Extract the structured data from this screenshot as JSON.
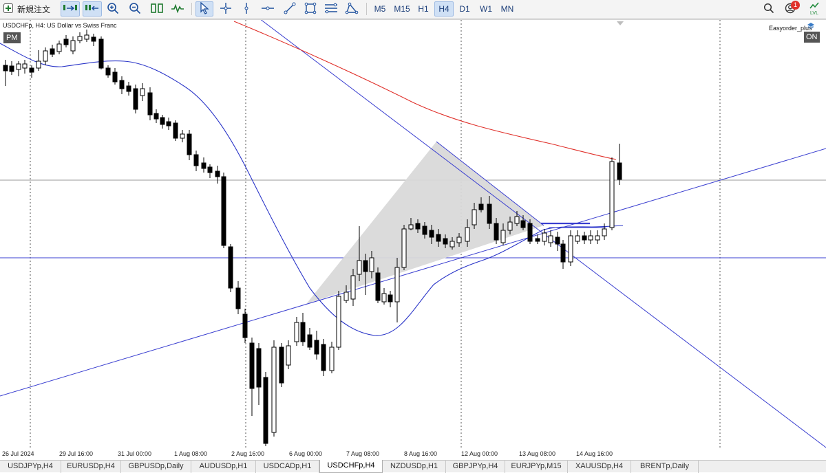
{
  "toolbar": {
    "new_order_label": "新規注文",
    "timeframes": [
      "M5",
      "M15",
      "H1",
      "H4",
      "D1",
      "W1",
      "MN"
    ],
    "active_timeframe": "H4",
    "notification_count": "1",
    "algo_label": "LVL"
  },
  "chart": {
    "title": "USDCHFp, H4:  US Dollar vs Swiss Franc",
    "pm_label": "PM",
    "ea_name": "Easyorder_plus",
    "ea_status": "ON",
    "time_labels": [
      "26 Jul 2024",
      "29 Jul 16:00",
      "31 Jul 00:00",
      "1 Aug 08:00",
      "2 Aug 16:00",
      "6 Aug 00:00",
      "7 Aug 08:00",
      "8 Aug 16:00",
      "12 Aug 00:00",
      "13 Aug 08:00",
      "14 Aug 16:00"
    ],
    "colors": {
      "ma_short": "#2a35c8",
      "ma_long": "#e0302a",
      "trendline": "#3a3fd0",
      "bear_candle": "#000000",
      "bull_candle": "#ffffff",
      "triangle_fill": "#d9d9d9"
    }
  },
  "tabs": [
    {
      "label": "USDJPYp,H4",
      "active": false
    },
    {
      "label": "EURUSDp,H4",
      "active": false
    },
    {
      "label": "GBPUSDp,Daily",
      "active": false
    },
    {
      "label": "AUDUSDp,H1",
      "active": false
    },
    {
      "label": "USDCADp,H1",
      "active": false
    },
    {
      "label": "USDCHFp,H4",
      "active": true
    },
    {
      "label": "NZDUSDp,H1",
      "active": false
    },
    {
      "label": "GBPJPYp,H4",
      "active": false
    },
    {
      "label": "EURJPYp,M15",
      "active": false
    },
    {
      "label": "XAUUSDp,H4",
      "active": false
    },
    {
      "label": "BRENTp,Daily",
      "active": false
    }
  ]
}
